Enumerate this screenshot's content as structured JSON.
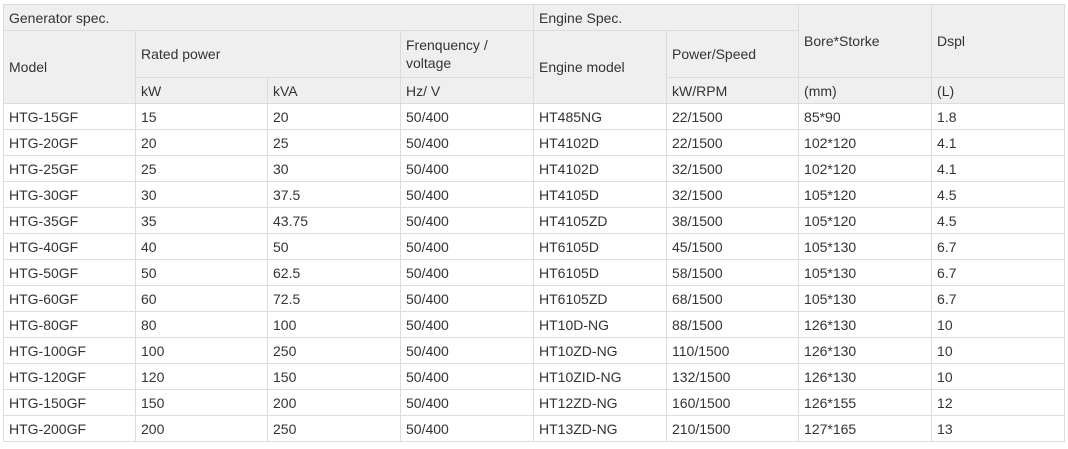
{
  "header": {
    "generator_spec": "Generator spec.",
    "engine_spec": "Engine Spec.",
    "bore_stroke": "Bore*Storke",
    "dspl": "Dspl",
    "model": "Model",
    "rated_power": "Rated power",
    "frequency_voltage": "Frenquency / voltage",
    "engine_model": "Engine model",
    "power_speed": "Power/Speed",
    "kw": "kW",
    "kva": "kVA",
    "hz_v": "Hz/ V",
    "kw_rpm": "kW/RPM",
    "mm": "(mm)",
    "l": "(L)"
  },
  "rows": [
    {
      "model": "HTG-15GF",
      "kw": "15",
      "kva": "20",
      "hz_v": "50/400",
      "engine": "HT485NG",
      "power_speed": "22/1500",
      "bore_stroke": "85*90",
      "dspl": "1.8"
    },
    {
      "model": "HTG-20GF",
      "kw": "20",
      "kva": "25",
      "hz_v": "50/400",
      "engine": "HT4102D",
      "power_speed": "22/1500",
      "bore_stroke": "102*120",
      "dspl": "4.1"
    },
    {
      "model": "HTG-25GF",
      "kw": "25",
      "kva": "30",
      "hz_v": "50/400",
      "engine": "HT4102D",
      "power_speed": "32/1500",
      "bore_stroke": "102*120",
      "dspl": "4.1"
    },
    {
      "model": "HTG-30GF",
      "kw": "30",
      "kva": "37.5",
      "hz_v": "50/400",
      "engine": "HT4105D",
      "power_speed": "32/1500",
      "bore_stroke": "105*120",
      "dspl": "4.5"
    },
    {
      "model": "HTG-35GF",
      "kw": "35",
      "kva": "43.75",
      "hz_v": "50/400",
      "engine": "HT4105ZD",
      "power_speed": "38/1500",
      "bore_stroke": "105*120",
      "dspl": "4.5"
    },
    {
      "model": "HTG-40GF",
      "kw": "40",
      "kva": "50",
      "hz_v": "50/400",
      "engine": "HT6105D",
      "power_speed": "45/1500",
      "bore_stroke": "105*130",
      "dspl": "6.7"
    },
    {
      "model": "HTG-50GF",
      "kw": "50",
      "kva": "62.5",
      "hz_v": "50/400",
      "engine": "HT6105D",
      "power_speed": "58/1500",
      "bore_stroke": "105*130",
      "dspl": "6.7"
    },
    {
      "model": "HTG-60GF",
      "kw": "60",
      "kva": "72.5",
      "hz_v": "50/400",
      "engine": "HT6105ZD",
      "power_speed": "68/1500",
      "bore_stroke": "105*130",
      "dspl": "6.7"
    },
    {
      "model": "HTG-80GF",
      "kw": "80",
      "kva": "100",
      "hz_v": "50/400",
      "engine": "HT10D-NG",
      "power_speed": "88/1500",
      "bore_stroke": "126*130",
      "dspl": "10"
    },
    {
      "model": "HTG-100GF",
      "kw": "100",
      "kva": "250",
      "hz_v": "50/400",
      "engine": "HT10ZD-NG",
      "power_speed": "110/1500",
      "bore_stroke": "126*130",
      "dspl": "10"
    },
    {
      "model": "HTG-120GF",
      "kw": "120",
      "kva": "150",
      "hz_v": "50/400",
      "engine": "HT10ZID-NG",
      "power_speed": "132/1500",
      "bore_stroke": "126*130",
      "dspl": "10"
    },
    {
      "model": "HTG-150GF",
      "kw": "150",
      "kva": "200",
      "hz_v": "50/400",
      "engine": "HT12ZD-NG",
      "power_speed": "160/1500",
      "bore_stroke": "126*155",
      "dspl": "12"
    },
    {
      "model": "HTG-200GF",
      "kw": "200",
      "kva": "250",
      "hz_v": "50/400",
      "engine": "HT13ZD-NG",
      "power_speed": "210/1500",
      "bore_stroke": "127*165",
      "dspl": "13"
    }
  ]
}
